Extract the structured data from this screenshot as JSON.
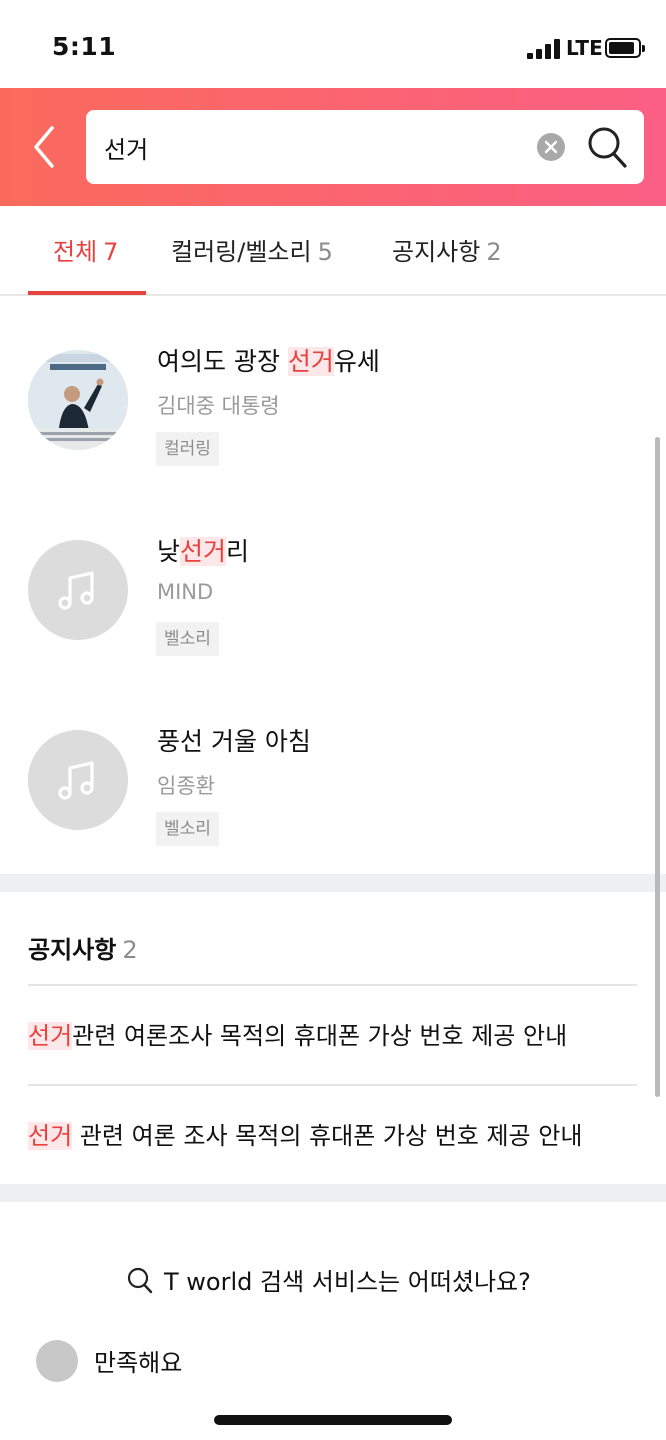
{
  "status_bar": {
    "time": "5:11",
    "network": "LTE"
  },
  "search": {
    "value": "선거"
  },
  "tabs": [
    {
      "label": "전체",
      "count": "7",
      "active": true
    },
    {
      "label": "컬러링/벨소리",
      "count": "5",
      "active": false
    },
    {
      "label": "공지사항",
      "count": "2",
      "active": false
    }
  ],
  "results": [
    {
      "title_pre": "여의도 광장 ",
      "title_hl": "선거",
      "title_post": "유세",
      "artist": "김대중 대통령",
      "tag": "컬러링",
      "thumb": "album-photo"
    },
    {
      "title_pre": "낮",
      "title_hl": "선거",
      "title_post": "리",
      "artist": "MIND",
      "tag": "벨소리",
      "thumb": "music-icon"
    },
    {
      "title_pre": "풍선 거울 아침",
      "title_hl": "",
      "title_post": "",
      "artist": "임종환",
      "tag": "벨소리",
      "thumb": "music-icon"
    }
  ],
  "notice": {
    "title": "공지사항",
    "count": "2",
    "items": [
      {
        "hl": "선거",
        "rest": "관련 여론조사 목적의 휴대폰 가상 번호 제공 안내"
      },
      {
        "hl": "선거",
        "rest": " 관련 여론 조사 목적의 휴대폰 가상 번호 제공 안내"
      }
    ]
  },
  "feedback": {
    "question": "T world 검색 서비스는 어떠셨나요?",
    "option": "만족해요"
  },
  "colors": {
    "accent": "#e8423f",
    "header_start": "#fa6a5c",
    "header_end": "#fb5f84"
  }
}
